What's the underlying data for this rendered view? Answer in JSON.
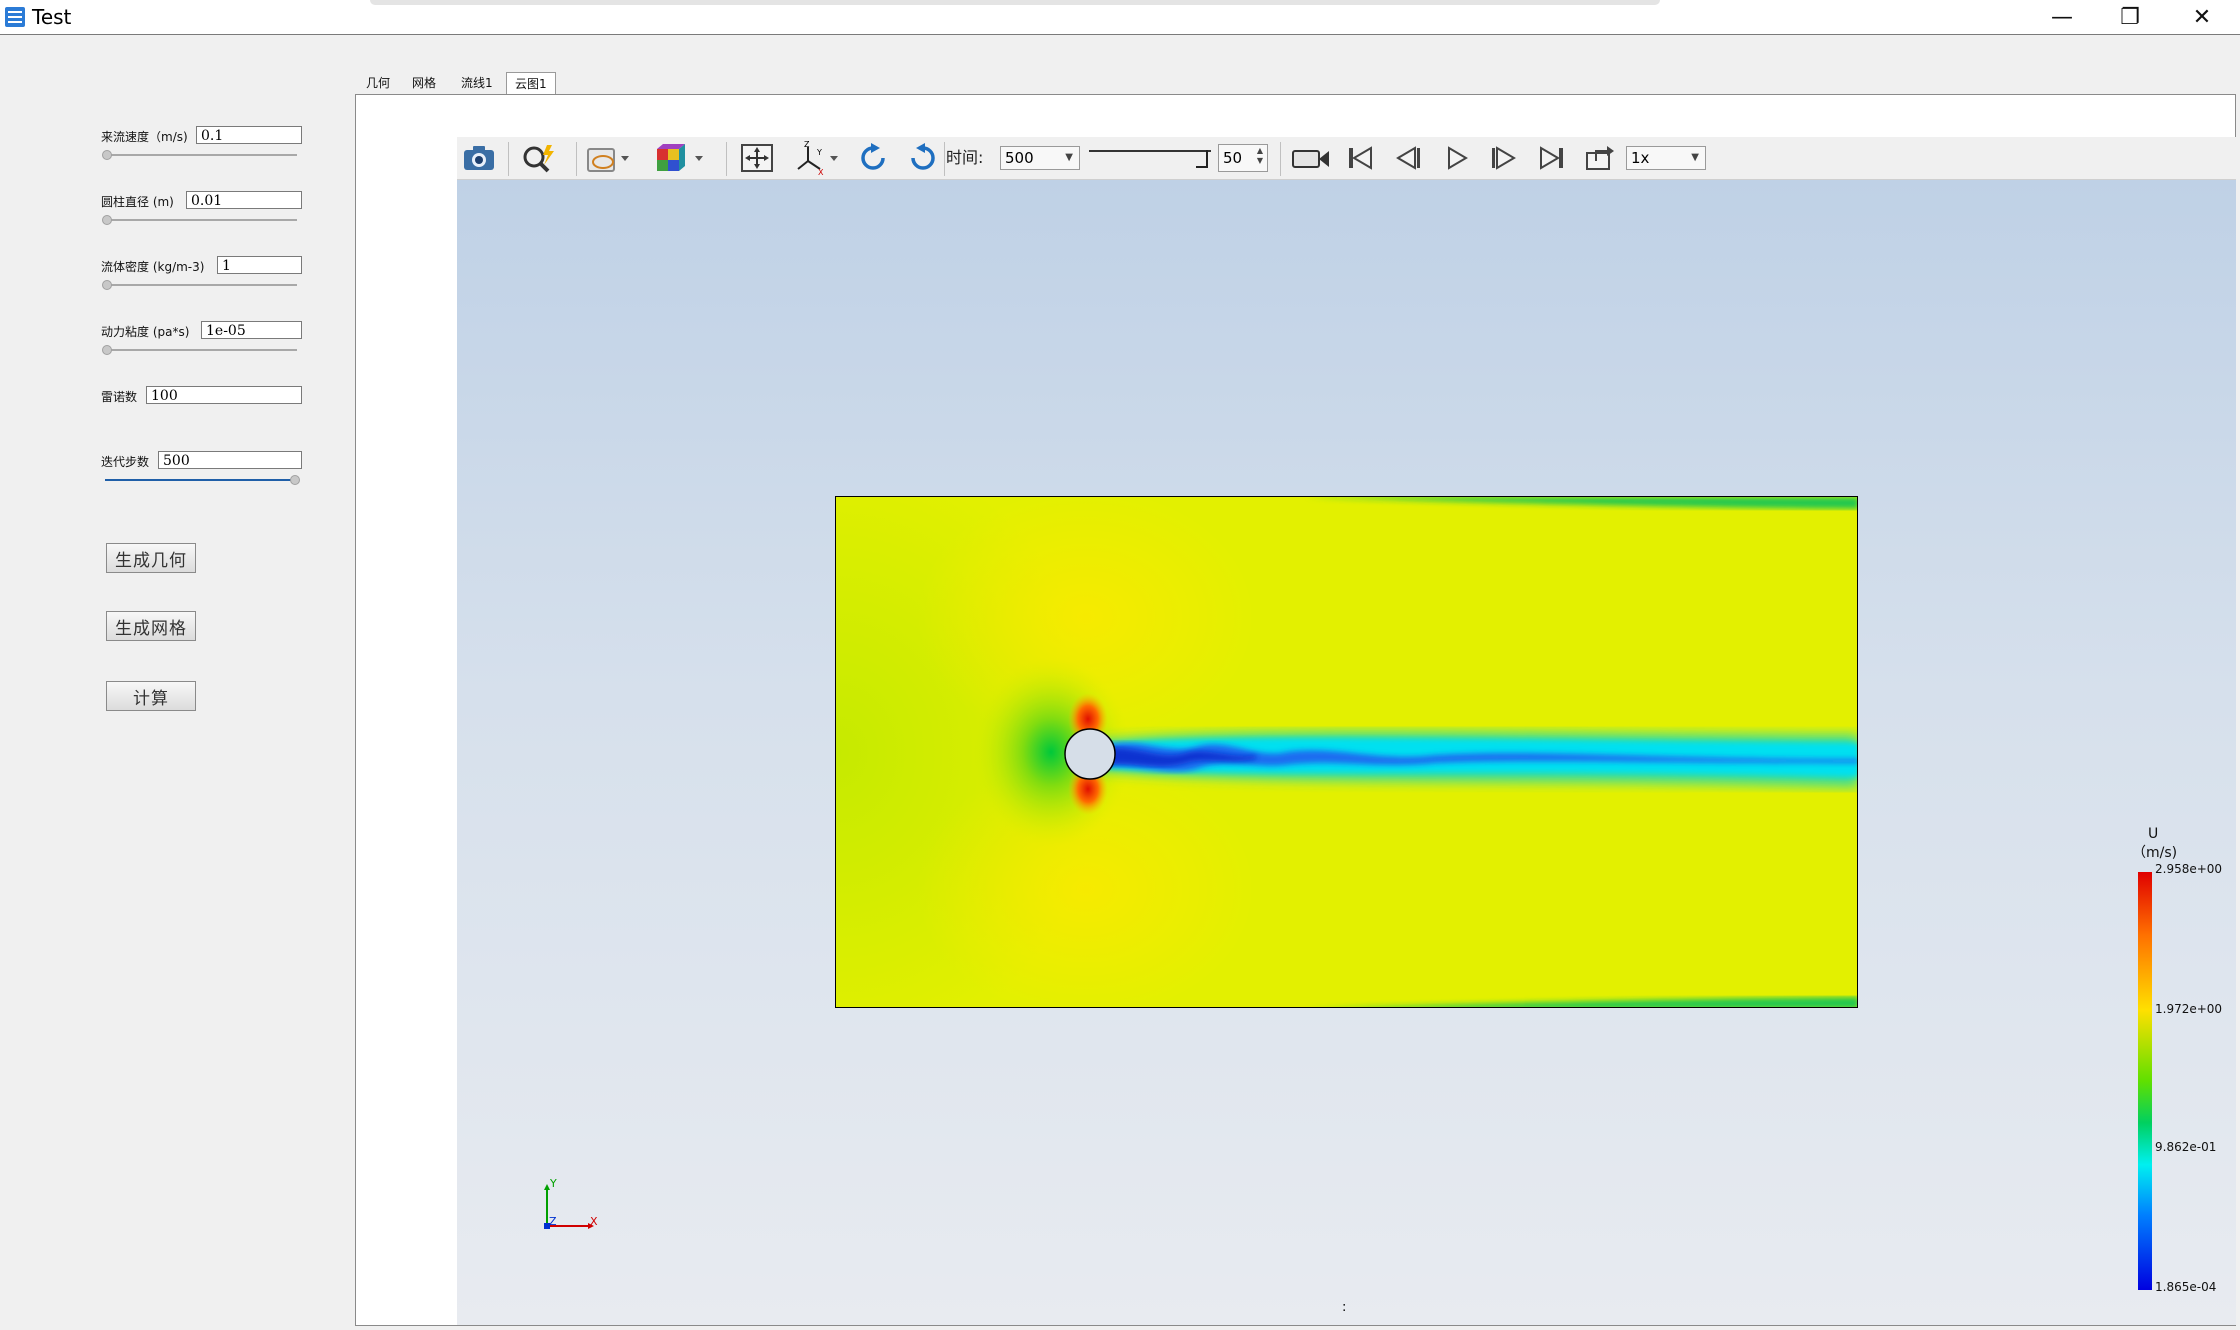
{
  "window": {
    "title": "Test",
    "minimize": "—",
    "restore": "❐",
    "close": "✕"
  },
  "params": [
    {
      "label": "来流速度（m/s)",
      "value": "0.1",
      "slider": 0.0
    },
    {
      "label": "圆柱直径 (m)",
      "value": "0.01",
      "slider": 0.0
    },
    {
      "label": "流体密度 (kg/m-3)",
      "value": "1",
      "slider": 0.0
    },
    {
      "label": "动力粘度 (pa*s)",
      "value": "1e-05",
      "slider": 0.0
    },
    {
      "label": "雷诺数",
      "value": "100"
    },
    {
      "label": "迭代步数",
      "value": "500",
      "slider": 1.0
    }
  ],
  "buttons": {
    "geometry": "生成几何",
    "mesh": "生成网格",
    "compute": "计算"
  },
  "tabs": [
    "几何",
    "网格",
    "流线1",
    "云图1"
  ],
  "active_tab": 3,
  "toolbar": {
    "time_label": "时间:",
    "time_value": "500",
    "frame_slider": 1.0,
    "frame_spin": "50",
    "speed": "1x"
  },
  "axes": {
    "x": "X",
    "y": "Y",
    "z": "Z"
  },
  "legend": {
    "title": "U",
    "unit": "（m/s)",
    "ticks": [
      "2.958e+00",
      "1.972e+00",
      "9.862e-01",
      "1.865e-04"
    ]
  },
  "status": ":",
  "colors": {
    "field_base": "#e3f000",
    "wake_core": "#1030e0",
    "stagnation": "#e01000"
  }
}
